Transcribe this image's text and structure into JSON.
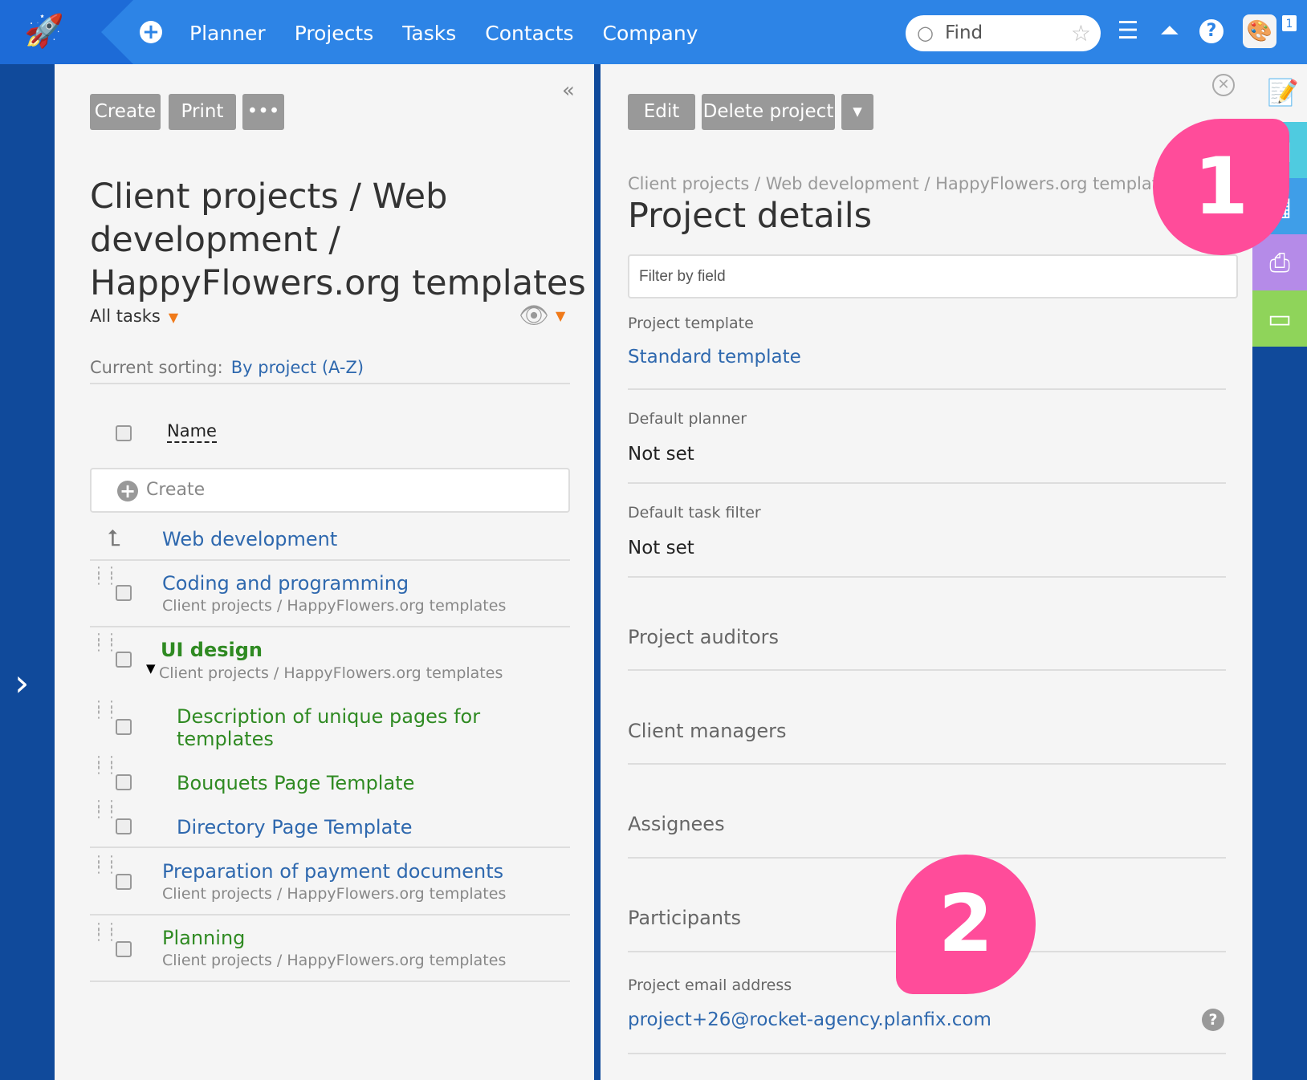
{
  "nav": {
    "items": [
      "Planner",
      "Projects",
      "Tasks",
      "Contacts",
      "Company"
    ],
    "search_placeholder": "Find",
    "notification_count": "1",
    "add_icon": "plus-circle-icon",
    "menu_icon": "hamburger-icon",
    "rocket_icon": "rocket-icon",
    "help_icon": "question-icon"
  },
  "left": {
    "buttons": {
      "create": "Create",
      "print": "Print",
      "more": "•••"
    },
    "title": "Client projects / Web development / HappyFlowers.org templates",
    "filter": "All tasks",
    "sorting_label": "Current sorting:",
    "sorting_value": "By project (A-Z)",
    "column_name": "Name",
    "create_placeholder": "Create",
    "parent": "Web development",
    "tasks": [
      {
        "title": "Coding and programming",
        "sub": "Client projects / HappyFlowers.org templates"
      },
      {
        "title": "UI design",
        "sub": "Client projects / HappyFlowers.org templates"
      },
      {
        "title": "Description of unique pages for templates"
      },
      {
        "title": "Bouquets Page Template"
      },
      {
        "title": "Directory Page Template"
      },
      {
        "title": "Preparation of payment documents",
        "sub": "Client projects / HappyFlowers.org templates"
      },
      {
        "title": "Planning",
        "sub": "Client projects / HappyFlowers.org templates"
      }
    ]
  },
  "right": {
    "buttons": {
      "edit": "Edit",
      "delete": "Delete project",
      "dropdown": "▾"
    },
    "breadcrumb": "Client projects / Web development / HappyFlowers.org templat",
    "title": "Project details",
    "filter_placeholder": "Filter by field",
    "fields": [
      {
        "label": "Project template",
        "value": "Standard template"
      },
      {
        "label": "Default planner",
        "value": "Not set"
      },
      {
        "label": "Default task filter",
        "value": "Not set"
      }
    ],
    "sections": [
      "Project auditors",
      "Client managers",
      "Assignees",
      "Participants"
    ],
    "email_label": "Project email address",
    "email_value": "project+26@rocket-agency.planfix.com"
  },
  "callouts": [
    "1",
    "2"
  ],
  "colors": {
    "topbar": "#2d84e6",
    "sidebar": "#104a9b",
    "link": "#2e68ae",
    "green": "#2f8a22",
    "callout": "#ff4c9a",
    "rail_cyan": "#4fcbe0",
    "rail_blue": "#3f9ee8",
    "rail_purple": "#b58be8",
    "rail_green": "#8fd45a"
  }
}
